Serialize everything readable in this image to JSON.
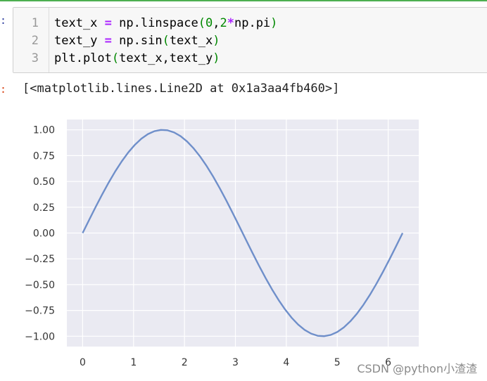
{
  "prompts": {
    "input": ":",
    "output": ":"
  },
  "code_cell": {
    "line_numbers": [
      "1",
      "2",
      "3"
    ],
    "lines": [
      [
        {
          "t": "text_x ",
          "k": "plain"
        },
        {
          "t": "=",
          "k": "op"
        },
        {
          "t": " np.linspace",
          "k": "plain"
        },
        {
          "t": "(",
          "k": "paren"
        },
        {
          "t": "0",
          "k": "num"
        },
        {
          "t": ",",
          "k": "plain"
        },
        {
          "t": "2",
          "k": "num"
        },
        {
          "t": "*",
          "k": "op"
        },
        {
          "t": "np.pi",
          "k": "plain"
        },
        {
          "t": ")",
          "k": "paren"
        }
      ],
      [
        {
          "t": "text_y ",
          "k": "plain"
        },
        {
          "t": "=",
          "k": "op"
        },
        {
          "t": " np.sin",
          "k": "plain"
        },
        {
          "t": "(",
          "k": "paren"
        },
        {
          "t": "text_x",
          "k": "plain"
        },
        {
          "t": ")",
          "k": "paren"
        }
      ],
      [
        {
          "t": "plt.plot",
          "k": "plain"
        },
        {
          "t": "(",
          "k": "paren"
        },
        {
          "t": "text_x,text_y",
          "k": "plain"
        },
        {
          "t": ")",
          "k": "paren"
        }
      ]
    ]
  },
  "output": {
    "text": "[<matplotlib.lines.Line2D at 0x1a3aa4fb460>]"
  },
  "chart_data": {
    "type": "line",
    "title": "",
    "xlabel": "",
    "ylabel": "",
    "xlim": [
      -0.31,
      6.6
    ],
    "ylim": [
      -1.1,
      1.1
    ],
    "xticks": [
      0,
      1,
      2,
      3,
      4,
      5,
      6
    ],
    "yticks": [
      1.0,
      0.75,
      0.5,
      0.25,
      0.0,
      -0.25,
      -0.5,
      -0.75,
      -1.0
    ],
    "ytick_labels": [
      "1.00",
      "0.75",
      "0.50",
      "0.25",
      "0.00",
      "−0.25",
      "−0.50",
      "−0.75",
      "−1.00"
    ],
    "grid": true,
    "style": "seaborn",
    "series": [
      {
        "function": "sin",
        "x_start": 0,
        "x_end": 6.283,
        "n_points": 50,
        "color": "#6f8fca"
      }
    ]
  },
  "colors": {
    "plot_background": "#eaeaf2",
    "grid": "#ffffff",
    "line": "#6f8fca"
  },
  "watermark": "CSDN @python小渣渣"
}
